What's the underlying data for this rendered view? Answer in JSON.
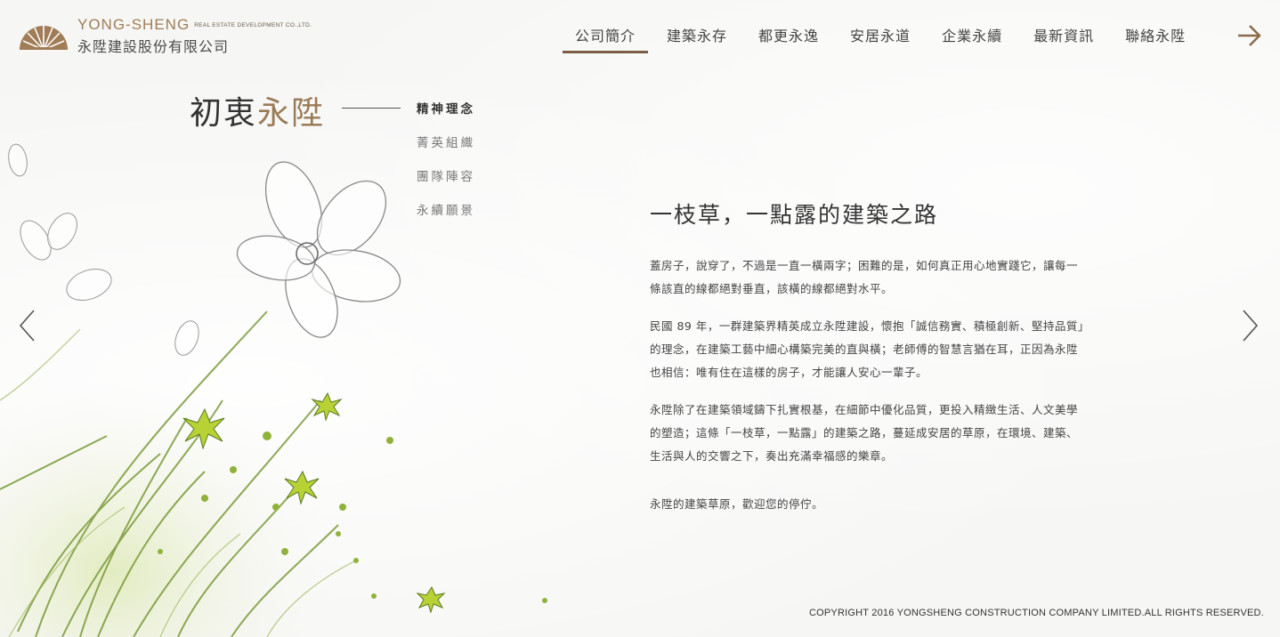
{
  "brand": {
    "name_en": "YONG-SHENG",
    "name_en_sub": "REAL ESTATE DEVELOPMENT CO.,LTD.",
    "name_zh": "永陞建設股份有限公司",
    "accent_color": "#9a7b57"
  },
  "nav": {
    "items": [
      {
        "label": "公司簡介",
        "active": true
      },
      {
        "label": "建築永存",
        "active": false
      },
      {
        "label": "都更永逸",
        "active": false
      },
      {
        "label": "安居永道",
        "active": false
      },
      {
        "label": "企業永續",
        "active": false
      },
      {
        "label": "最新資訊",
        "active": false
      },
      {
        "label": "聯絡永陞",
        "active": false
      }
    ],
    "next_icon": "arrow-right-icon"
  },
  "page": {
    "title_part1": "初衷",
    "title_part2": "永陞"
  },
  "subnav": {
    "items": [
      {
        "label": "精神理念",
        "active": true
      },
      {
        "label": "菁英組織",
        "active": false
      },
      {
        "label": "團隊陣容",
        "active": false
      },
      {
        "label": "永續願景",
        "active": false
      }
    ]
  },
  "content": {
    "heading": "一枝草，一點露的建築之路",
    "p1_line1": "蓋房子，說穿了，不過是一直一橫兩字；困難的是，如何真正用心地實踐它，讓每一",
    "p1_line2": "條該直的線都絕對垂直，該橫的線都絕對水平。",
    "p2_line1": "民國 89 年，一群建築界精英成立永陞建設，懷抱「誠信務實、積極創新、堅持品質」",
    "p2_line2": "的理念，在建築工藝中細心構築完美的直與橫；老師傅的智慧言猶在耳，正因為永陞",
    "p2_line3": "也相信：唯有住在這樣的房子，才能讓人安心一輩子。",
    "p3_line1": "永陞除了在建築領域鑄下扎實根基，在細節中優化品質，更投入精緻生活、人文美學",
    "p3_line2": "的塑造；這條「一枝草，一點露」的建築之路，蔓延成安居的草原，在環境、建築、",
    "p3_line3": "生活與人的交響之下，奏出充滿幸福感的樂章。",
    "closing": "永陞的建築草原，歡迎您的停佇。"
  },
  "slider": {
    "prev_icon": "chevron-left-icon",
    "next_icon": "chevron-right-icon"
  },
  "footer": {
    "copyright": "COPYRIGHT 2016 YONGSHENG CONSTRUCTION COMPANY LIMITED.ALL RIGHTS RESERVED."
  }
}
